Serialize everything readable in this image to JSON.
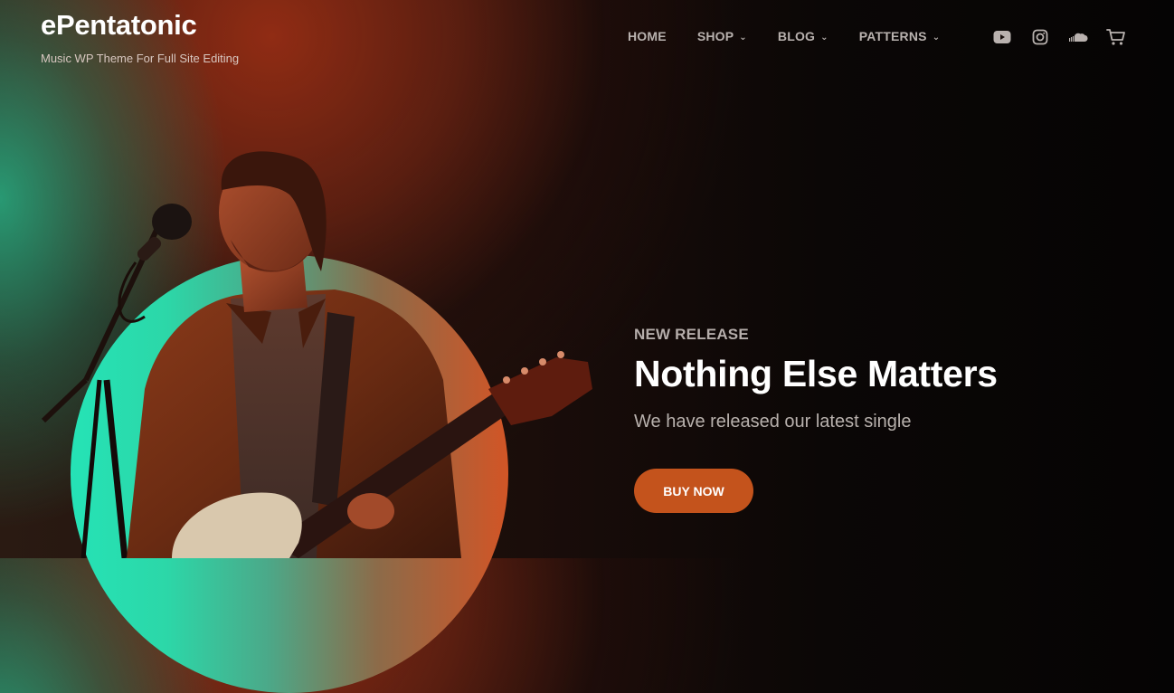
{
  "site": {
    "title": "ePentatonic",
    "tagline": "Music WP Theme For Full Site Editing"
  },
  "nav": {
    "items": [
      {
        "label": "HOME",
        "dropdown": false
      },
      {
        "label": "SHOP",
        "dropdown": true
      },
      {
        "label": "BLOG",
        "dropdown": true
      },
      {
        "label": "PATTERNS",
        "dropdown": true
      }
    ],
    "chevron": "⌄"
  },
  "social_icons": [
    "youtube-icon",
    "instagram-icon",
    "soundcloud-icon",
    "cart-icon"
  ],
  "hero": {
    "eyebrow": "NEW RELEASE",
    "title": "Nothing Else Matters",
    "subtitle": "We have released our latest single",
    "cta_label": "BUY NOW"
  },
  "colors": {
    "accent": "#c4531c",
    "circle_teal": "#25e3b6",
    "circle_orange": "#d25526",
    "nav_text": "#b9b2af"
  }
}
